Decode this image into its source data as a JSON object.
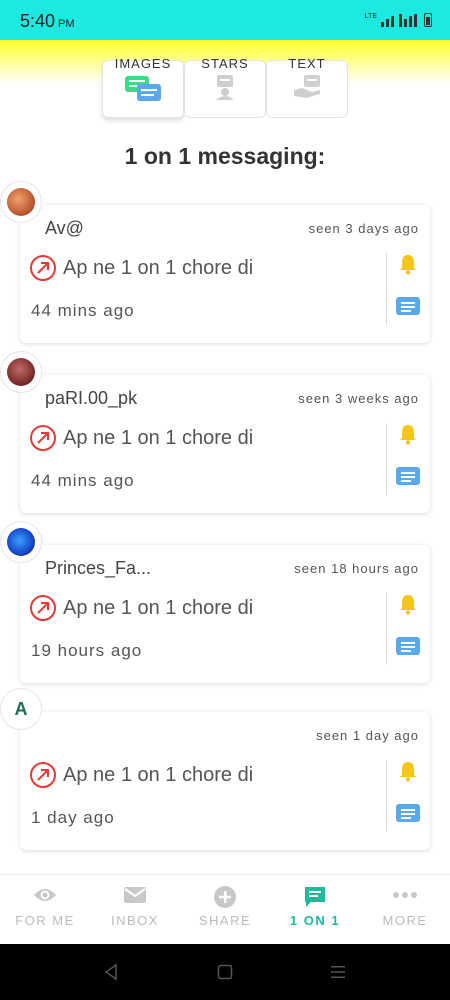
{
  "status_bar": {
    "time": "5:40",
    "ampm": "PM",
    "network": "LTE"
  },
  "tabs": [
    {
      "label": "IMAGES",
      "icon": "chat-bubbles-icon",
      "active": true
    },
    {
      "label": "STARS",
      "icon": "award-icon",
      "active": false
    },
    {
      "label": "TEXT",
      "icon": "hand-card-icon",
      "active": false
    }
  ],
  "section_title": "1 on 1 messaging:",
  "conversations": [
    {
      "username": "Av@",
      "seen": "seen 3 days ago",
      "message": "Ap ne 1 on 1 chore di",
      "time_ago": "44 mins ago",
      "avatar": "photo",
      "avatar_color": "#b5502e"
    },
    {
      "username": "paRI.00_pk",
      "seen": "seen 3 weeks ago",
      "message": "Ap ne 1 on 1 chore di",
      "time_ago": "44 mins ago",
      "avatar": "photo",
      "avatar_color": "#7a2a2a"
    },
    {
      "username": "Princes_Fa...",
      "seen": "seen 18 hours ago",
      "message": "Ap ne 1 on 1 chore di",
      "time_ago": "19 hours ago",
      "avatar": "photo",
      "avatar_color": "#1746c9"
    },
    {
      "username": "",
      "seen": "seen 1 day ago",
      "message": "Ap ne 1 on 1 chore di",
      "time_ago": "1 day ago",
      "avatar": "letter",
      "avatar_letter": "A"
    }
  ],
  "bottom_nav": [
    {
      "label": "FOR ME",
      "icon": "eye-icon",
      "active": false
    },
    {
      "label": "INBOX",
      "icon": "envelope-icon",
      "active": false
    },
    {
      "label": "SHARE",
      "icon": "plus-circle-icon",
      "active": false
    },
    {
      "label": "1 ON 1",
      "icon": "message-icon",
      "active": true
    },
    {
      "label": "MORE",
      "icon": "more-dots-icon",
      "active": false
    }
  ],
  "colors": {
    "accent": "#1abc9c",
    "status_bar": "#1de9e0",
    "alert_red": "#e53935",
    "bell": "#f5c518",
    "chat_icon": "#5aa9ec"
  }
}
